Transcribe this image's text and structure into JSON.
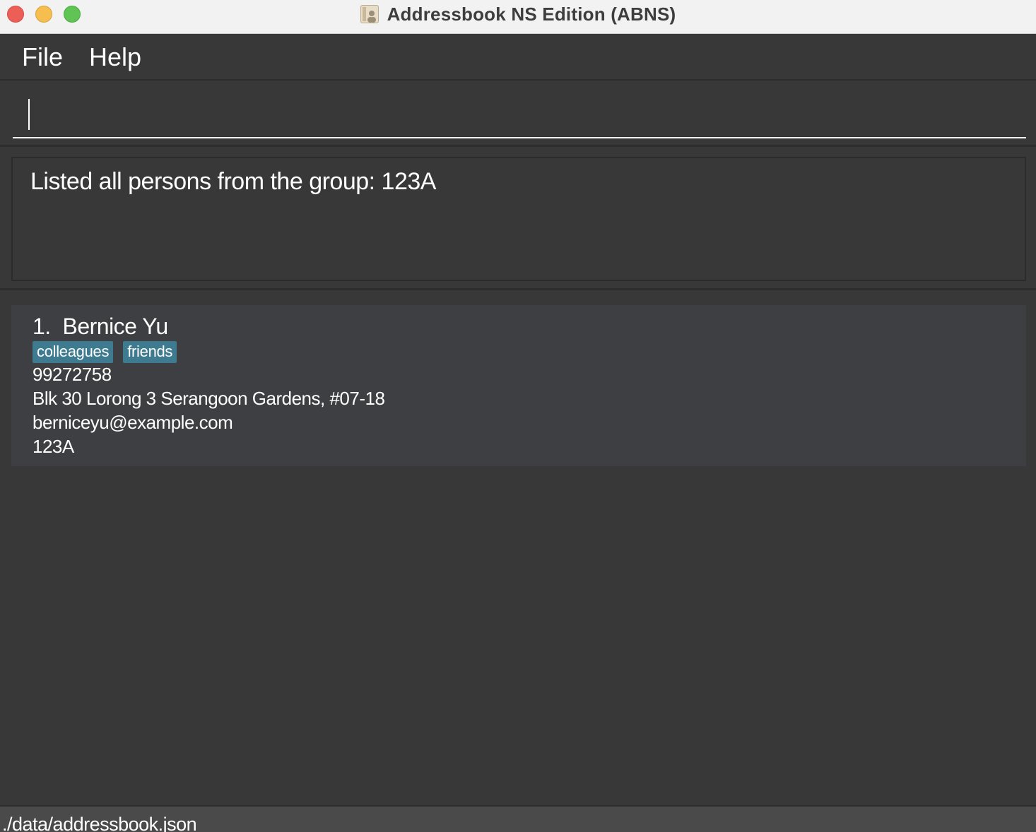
{
  "window": {
    "title": "Addressbook NS Edition (ABNS)",
    "buttons": {
      "close": "close-icon",
      "minimize": "minimize-icon",
      "maximize": "maximize-icon"
    },
    "icon": "addressbook-app-icon"
  },
  "menu": {
    "items": [
      {
        "label": "File"
      },
      {
        "label": "Help"
      }
    ]
  },
  "command": {
    "value": "",
    "placeholder": ""
  },
  "result": {
    "message": "Listed all persons from the group: 123A"
  },
  "persons": [
    {
      "index_name": "1.  Bernice Yu",
      "tags": [
        "colleagues",
        "friends"
      ],
      "phone": "99272758",
      "address": "Blk 30 Lorong 3 Serangoon Gardens, #07-18",
      "email": "berniceyu@example.com",
      "group": "123A"
    }
  ],
  "status": {
    "path": "./data/addressbook.json"
  },
  "colors": {
    "background": "#383838",
    "card": "#3e3f42",
    "tag": "#3e7b91",
    "titlebar": "#f2f2f2"
  }
}
